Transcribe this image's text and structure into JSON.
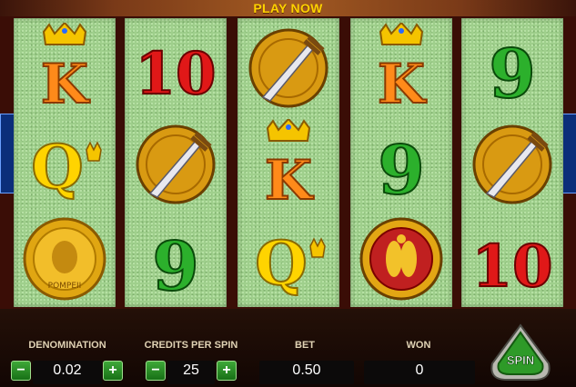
{
  "header": {
    "play_now_label": "PLAY NOW"
  },
  "reels": [
    [
      "king-K",
      "queen-Q",
      "gold-coin"
    ],
    [
      "red-10",
      "sword-shield",
      "green-9"
    ],
    [
      "sword-shield",
      "king-K",
      "queen-Q"
    ],
    [
      "king-K",
      "green-9",
      "jewel-scarab"
    ],
    [
      "green-9",
      "sword-shield",
      "red-10"
    ]
  ],
  "symbols": {
    "K": "K",
    "Q": "Q",
    "ten": "10",
    "nine": "9",
    "coin_text": "POMPEII"
  },
  "controls": {
    "denomination_label": "DENOMINATION",
    "denomination_value": "0.02",
    "credits_label": "CREDITS PER SPIN",
    "credits_value": "25",
    "bet_label": "BET",
    "bet_value": "0.50",
    "won_label": "WON",
    "won_value": "0",
    "minus": "−",
    "plus": "+",
    "spin_label": "SPIN"
  },
  "colors": {
    "reel_bg": "#9fcf8c",
    "accent_gold": "#ffd200",
    "button_green": "#2e9a28",
    "frame": "#3a0d06"
  }
}
